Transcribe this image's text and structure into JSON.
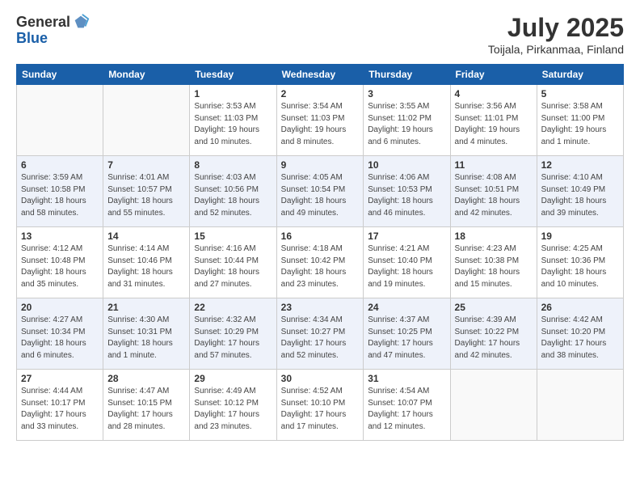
{
  "header": {
    "logo_general": "General",
    "logo_blue": "Blue",
    "month": "July 2025",
    "location": "Toijala, Pirkanmaa, Finland"
  },
  "days_of_week": [
    "Sunday",
    "Monday",
    "Tuesday",
    "Wednesday",
    "Thursday",
    "Friday",
    "Saturday"
  ],
  "weeks": [
    [
      {
        "day": "",
        "info": ""
      },
      {
        "day": "",
        "info": ""
      },
      {
        "day": "1",
        "info": "Sunrise: 3:53 AM\nSunset: 11:03 PM\nDaylight: 19 hours\nand 10 minutes."
      },
      {
        "day": "2",
        "info": "Sunrise: 3:54 AM\nSunset: 11:03 PM\nDaylight: 19 hours\nand 8 minutes."
      },
      {
        "day": "3",
        "info": "Sunrise: 3:55 AM\nSunset: 11:02 PM\nDaylight: 19 hours\nand 6 minutes."
      },
      {
        "day": "4",
        "info": "Sunrise: 3:56 AM\nSunset: 11:01 PM\nDaylight: 19 hours\nand 4 minutes."
      },
      {
        "day": "5",
        "info": "Sunrise: 3:58 AM\nSunset: 11:00 PM\nDaylight: 19 hours\nand 1 minute."
      }
    ],
    [
      {
        "day": "6",
        "info": "Sunrise: 3:59 AM\nSunset: 10:58 PM\nDaylight: 18 hours\nand 58 minutes."
      },
      {
        "day": "7",
        "info": "Sunrise: 4:01 AM\nSunset: 10:57 PM\nDaylight: 18 hours\nand 55 minutes."
      },
      {
        "day": "8",
        "info": "Sunrise: 4:03 AM\nSunset: 10:56 PM\nDaylight: 18 hours\nand 52 minutes."
      },
      {
        "day": "9",
        "info": "Sunrise: 4:05 AM\nSunset: 10:54 PM\nDaylight: 18 hours\nand 49 minutes."
      },
      {
        "day": "10",
        "info": "Sunrise: 4:06 AM\nSunset: 10:53 PM\nDaylight: 18 hours\nand 46 minutes."
      },
      {
        "day": "11",
        "info": "Sunrise: 4:08 AM\nSunset: 10:51 PM\nDaylight: 18 hours\nand 42 minutes."
      },
      {
        "day": "12",
        "info": "Sunrise: 4:10 AM\nSunset: 10:49 PM\nDaylight: 18 hours\nand 39 minutes."
      }
    ],
    [
      {
        "day": "13",
        "info": "Sunrise: 4:12 AM\nSunset: 10:48 PM\nDaylight: 18 hours\nand 35 minutes."
      },
      {
        "day": "14",
        "info": "Sunrise: 4:14 AM\nSunset: 10:46 PM\nDaylight: 18 hours\nand 31 minutes."
      },
      {
        "day": "15",
        "info": "Sunrise: 4:16 AM\nSunset: 10:44 PM\nDaylight: 18 hours\nand 27 minutes."
      },
      {
        "day": "16",
        "info": "Sunrise: 4:18 AM\nSunset: 10:42 PM\nDaylight: 18 hours\nand 23 minutes."
      },
      {
        "day": "17",
        "info": "Sunrise: 4:21 AM\nSunset: 10:40 PM\nDaylight: 18 hours\nand 19 minutes."
      },
      {
        "day": "18",
        "info": "Sunrise: 4:23 AM\nSunset: 10:38 PM\nDaylight: 18 hours\nand 15 minutes."
      },
      {
        "day": "19",
        "info": "Sunrise: 4:25 AM\nSunset: 10:36 PM\nDaylight: 18 hours\nand 10 minutes."
      }
    ],
    [
      {
        "day": "20",
        "info": "Sunrise: 4:27 AM\nSunset: 10:34 PM\nDaylight: 18 hours\nand 6 minutes."
      },
      {
        "day": "21",
        "info": "Sunrise: 4:30 AM\nSunset: 10:31 PM\nDaylight: 18 hours\nand 1 minute."
      },
      {
        "day": "22",
        "info": "Sunrise: 4:32 AM\nSunset: 10:29 PM\nDaylight: 17 hours\nand 57 minutes."
      },
      {
        "day": "23",
        "info": "Sunrise: 4:34 AM\nSunset: 10:27 PM\nDaylight: 17 hours\nand 52 minutes."
      },
      {
        "day": "24",
        "info": "Sunrise: 4:37 AM\nSunset: 10:25 PM\nDaylight: 17 hours\nand 47 minutes."
      },
      {
        "day": "25",
        "info": "Sunrise: 4:39 AM\nSunset: 10:22 PM\nDaylight: 17 hours\nand 42 minutes."
      },
      {
        "day": "26",
        "info": "Sunrise: 4:42 AM\nSunset: 10:20 PM\nDaylight: 17 hours\nand 38 minutes."
      }
    ],
    [
      {
        "day": "27",
        "info": "Sunrise: 4:44 AM\nSunset: 10:17 PM\nDaylight: 17 hours\nand 33 minutes."
      },
      {
        "day": "28",
        "info": "Sunrise: 4:47 AM\nSunset: 10:15 PM\nDaylight: 17 hours\nand 28 minutes."
      },
      {
        "day": "29",
        "info": "Sunrise: 4:49 AM\nSunset: 10:12 PM\nDaylight: 17 hours\nand 23 minutes."
      },
      {
        "day": "30",
        "info": "Sunrise: 4:52 AM\nSunset: 10:10 PM\nDaylight: 17 hours\nand 17 minutes."
      },
      {
        "day": "31",
        "info": "Sunrise: 4:54 AM\nSunset: 10:07 PM\nDaylight: 17 hours\nand 12 minutes."
      },
      {
        "day": "",
        "info": ""
      },
      {
        "day": "",
        "info": ""
      }
    ]
  ]
}
